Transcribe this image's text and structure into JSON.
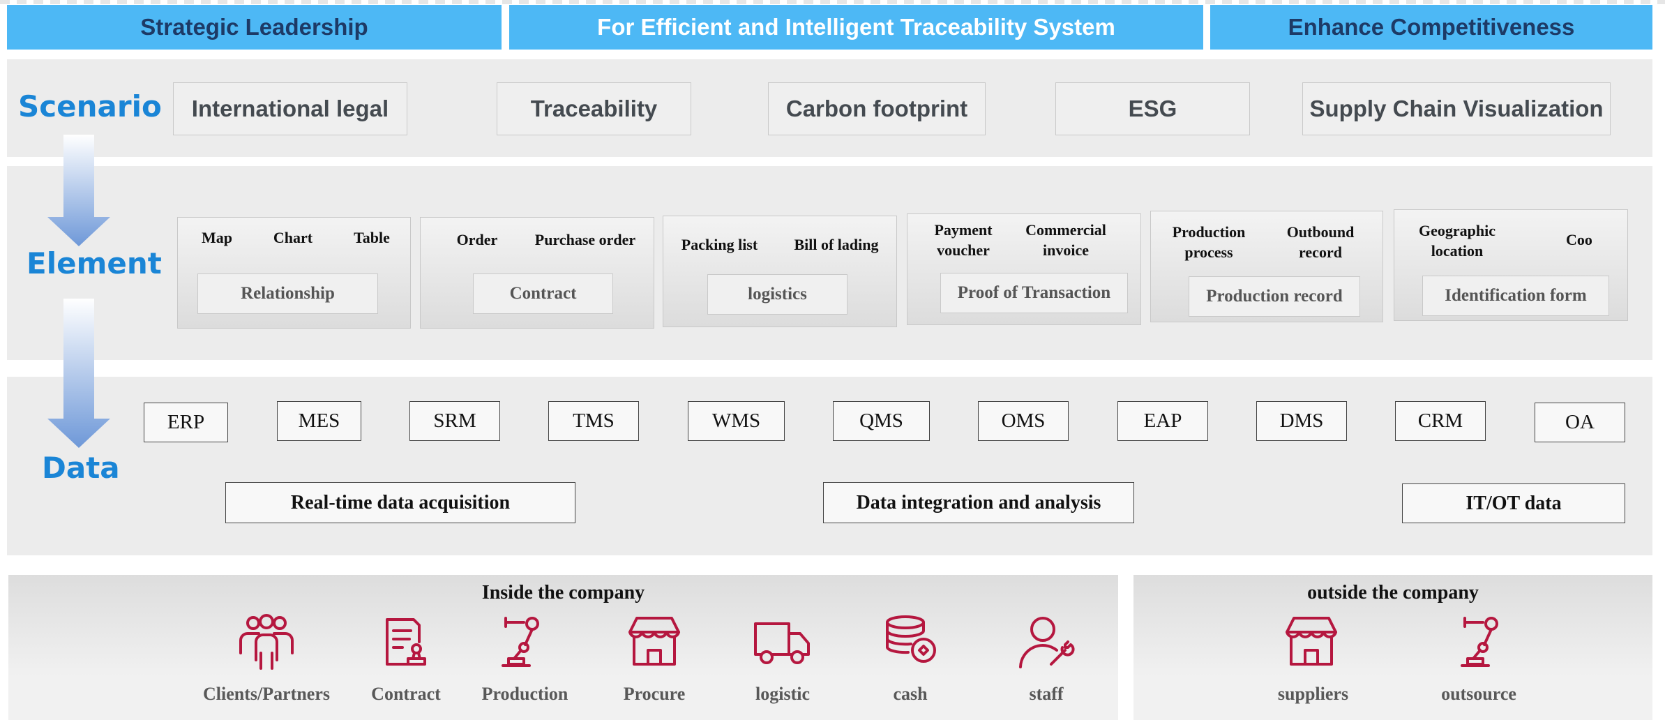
{
  "header": {
    "left": "Strategic Leadership",
    "center": "For Efficient and Intelligent Traceability System",
    "right": "Enhance Competitiveness"
  },
  "levels": {
    "scenario": "Scenario",
    "element": "Element",
    "data": "Data"
  },
  "scenarios": [
    "International legal",
    "Traceability",
    "Carbon footprint",
    "ESG",
    "Supply Chain Visualization"
  ],
  "elements": [
    {
      "subs": [
        "Map",
        "Chart",
        "Table"
      ],
      "box": "Relationship"
    },
    {
      "subs": [
        "Order",
        "Purchase order"
      ],
      "box": "Contract"
    },
    {
      "subs": [
        "Packing list",
        "Bill of lading"
      ],
      "box": "logistics"
    },
    {
      "subs": [
        "Payment voucher",
        "Commercial invoice"
      ],
      "box": "Proof of Transaction"
    },
    {
      "subs": [
        "Production process",
        "Outbound record"
      ],
      "box": "Production record"
    },
    {
      "subs": [
        "Geographic location",
        "Coo"
      ],
      "box": "Identification form"
    }
  ],
  "systems": [
    "ERP",
    "MES",
    "SRM",
    "TMS",
    "WMS",
    "QMS",
    "OMS",
    "EAP",
    "DMS",
    "CRM",
    "OA"
  ],
  "data_bottom": [
    "Real-time data acquisition",
    "Data integration and analysis",
    "IT/OT data"
  ],
  "inside": {
    "title": "Inside the company",
    "items": [
      {
        "label": "Clients/Partners",
        "icon": "people-icon"
      },
      {
        "label": "Contract",
        "icon": "contract-icon"
      },
      {
        "label": "Production",
        "icon": "robot-arm-icon"
      },
      {
        "label": "Procure",
        "icon": "store-icon"
      },
      {
        "label": "logistic",
        "icon": "truck-icon"
      },
      {
        "label": "cash",
        "icon": "coins-icon"
      },
      {
        "label": "staff",
        "icon": "staff-wrench-icon"
      }
    ]
  },
  "outside": {
    "title": "outside the company",
    "items": [
      {
        "label": "suppliers",
        "icon": "store-icon"
      },
      {
        "label": "outsource",
        "icon": "robot-arm-icon"
      }
    ]
  },
  "colors": {
    "header": "#4db8f5",
    "level_text": "#1a85d6",
    "icon": "#b5173f",
    "arrow": "#7fa6dd"
  }
}
